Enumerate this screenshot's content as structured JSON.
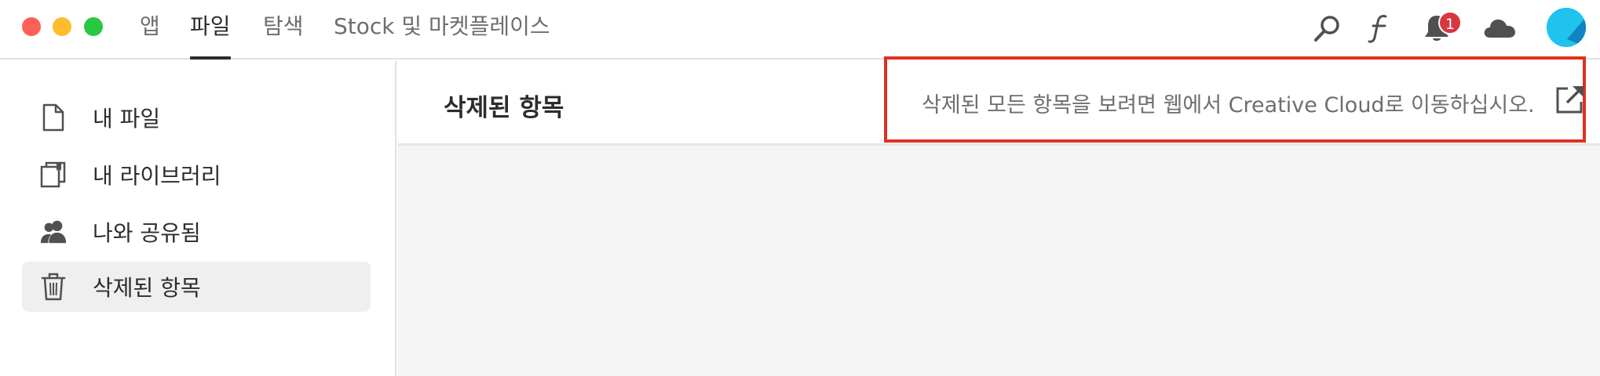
{
  "window": {
    "controls": {
      "close": "close-control",
      "minimize": "minimize-control",
      "maximize": "maximize-control"
    }
  },
  "nav": {
    "tabs": [
      {
        "label": "앱",
        "active": false
      },
      {
        "label": "파일",
        "active": true
      },
      {
        "label": "탐색",
        "active": false
      },
      {
        "label": "Stock 및 마켓플레이스",
        "active": false
      }
    ]
  },
  "toolbar": {
    "icons": [
      "search-icon",
      "fonts-icon",
      "bell-icon",
      "cloud-icon",
      "avatar"
    ],
    "notification_count": "1",
    "badge_color": "#d7373f"
  },
  "sidebar": {
    "items": [
      {
        "label": "내 파일",
        "icon": "file-icon",
        "selected": false
      },
      {
        "label": "내 라이브러리",
        "icon": "library-icon",
        "selected": false
      },
      {
        "label": "나와 공유됨",
        "icon": "users-icon",
        "selected": false
      },
      {
        "label": "삭제된 항목",
        "icon": "trash-icon",
        "selected": true
      }
    ]
  },
  "main": {
    "title": "삭제된 항목",
    "info_text": "삭제된 모든 항목을 보려면 웹에서 Creative Cloud로 이동하십시오.",
    "highlight_color": "#e0301e"
  }
}
